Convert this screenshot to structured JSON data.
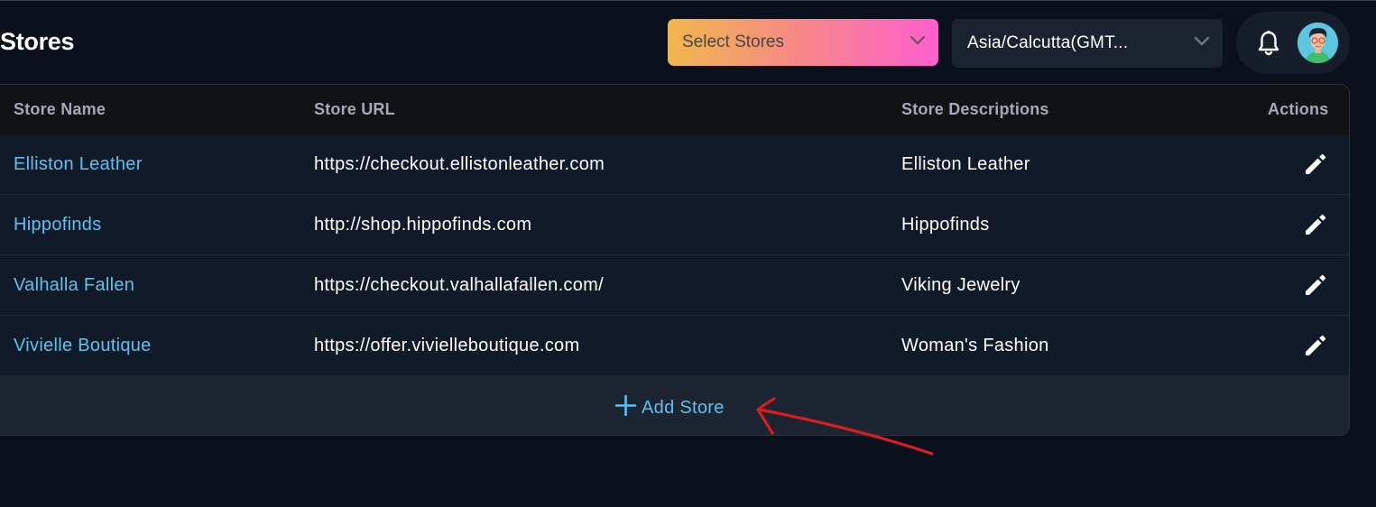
{
  "header": {
    "title": "Stores",
    "store_select_placeholder": "Select Stores",
    "timezone_value": "Asia/Calcutta(GMT..."
  },
  "table": {
    "columns": [
      "Store Name",
      "Store URL",
      "Store Descriptions",
      "Actions"
    ],
    "rows": [
      {
        "name": "Elliston Leather",
        "url": "https://checkout.ellistonleather.com",
        "description": "Elliston Leather"
      },
      {
        "name": "Hippofinds",
        "url": "http://shop.hippofinds.com",
        "description": "Hippofinds"
      },
      {
        "name": "Valhalla Fallen",
        "url": "https://checkout.valhallafallen.com/",
        "description": "Viking Jewelry"
      },
      {
        "name": "Vivielle Boutique",
        "url": "https://offer.vivielleboutique.com",
        "description": "Woman's Fashion"
      }
    ],
    "add_label": "Add Store"
  },
  "icons": {
    "chevron": "chevron-down-icon",
    "bell": "bell-icon",
    "edit": "pencil-icon",
    "plus": "plus-icon"
  },
  "colors": {
    "background": "#0b111c",
    "link": "#5fc1ef",
    "gradient_start": "#f0b84c",
    "gradient_end": "#ff5fce",
    "annotation_arrow": "#d81e1e"
  }
}
